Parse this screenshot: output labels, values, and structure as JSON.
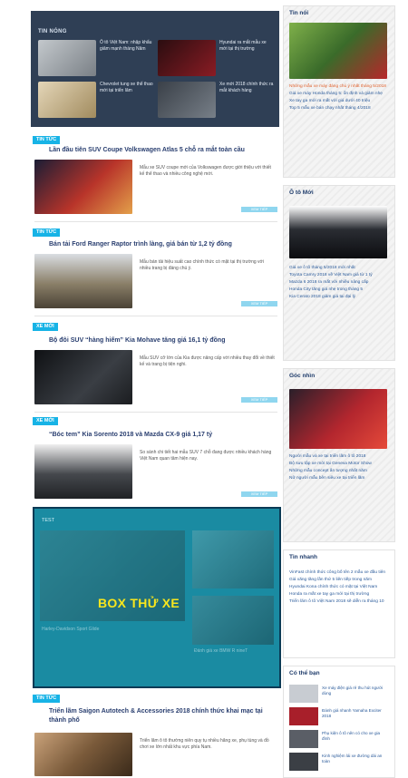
{
  "featured": {
    "header": "TIN NÓNG",
    "items": [
      {
        "caption": "Ô tô Việt Nam: nhập khẩu giảm mạnh tháng Năm",
        "color": "#9aa3a8"
      },
      {
        "caption": "Hyundai ra mắt mẫu xe mới tại thị trường",
        "color": "#7a1a20"
      },
      {
        "caption": "Chevrolet tung xe thể thao mới tại triển lãm",
        "color": "#c9b38a"
      },
      {
        "caption": "Xe mới 2018 chính thức ra mắt khách hàng",
        "color": "#4b5560"
      }
    ]
  },
  "articles": [
    {
      "tag": "TIN TỨC",
      "title": "Lần đầu tiên SUV Coupe Volkswagen Atlas 5 chỗ ra mắt toàn cầu",
      "summary": "Mẫu xe SUV coupe mới của Volkswagen được giới thiệu với thiết kế thể thao và nhiều công nghệ mới.",
      "more": "XEM TIẾP",
      "color": "#b8342a"
    },
    {
      "tag": "TIN TỨC",
      "title": "Bán tải Ford Ranger Raptor trình làng, giá bán từ 1,2 tỷ đồng",
      "summary": "Mẫu bán tải hiệu suất cao chính thức có mặt tại thị trường với nhiều trang bị đáng chú ý.",
      "more": "XEM TIẾP",
      "color": "#8a7f68"
    },
    {
      "tag": "XE MỚI",
      "title": "Bộ đôi SUV “hàng hiếm” Kia Mohave tăng giá 16,1 tỷ đồng",
      "summary": "Mẫu SUV cỡ lớn của Kia được nâng cấp với nhiều thay đổi về thiết kế và trang bị tiện nghi.",
      "more": "XEM TIẾP",
      "color": "#2b2e33"
    },
    {
      "tag": "XE MỚI",
      "title": "“Bóc tem” Kia Sorento 2018 và Mazda CX-9 giá 1,17 tỷ",
      "summary": "So sánh chi tiết hai mẫu SUV 7 chỗ đang được nhiều khách hàng Việt Nam quan tâm hiện nay.",
      "more": "XEM TIẾP",
      "color": "#45484d"
    },
    {
      "tag": "TIN TỨC",
      "title": "Triển lãm Saigon Autotech & Accessories 2018 chính thức khai mạc",
      "title2": "tại thành phố",
      "summary": "Triển lãm ô tô thường niên quy tụ nhiều hãng xe, phụ tùng và đồ chơi xe lớn nhất khu vực phía Nam.",
      "more": "",
      "color": "#7a5a3a"
    }
  ],
  "testbox": {
    "label": "TEST",
    "title": "BOX THỬ XE",
    "items": [
      "Harley-Davidson Sport Glide",
      "Đánh giá xe BMW R nineT",
      "Trải nghiệm Ducati Monster 2018"
    ]
  },
  "sidebar": {
    "widgets": [
      {
        "title": "Tin nổi",
        "img_color": "#3a6b2a",
        "items": [
          {
            "text": "Những mẫu xe máy đáng chú ý nhất tháng 5/2018",
            "bold": true
          },
          {
            "text": "Giá xe máy Honda tháng 5: ổn định và giảm nhẹ",
            "bold": false
          },
          {
            "text": "Xe tay ga mới ra mắt với giá dưới 40 triệu",
            "bold": false
          },
          {
            "text": "Top 5 mẫu xe bán chạy nhất tháng 4/2018",
            "bold": false
          }
        ]
      },
      {
        "title": "Ô tô Mới",
        "img_color": "#1c1f24",
        "items": [
          {
            "text": "Giá xe ô tô tháng 5/2018 mới nhất",
            "bold": false
          },
          {
            "text": "Toyota Camry 2018 về Việt Nam giá từ 1 tỷ",
            "bold": false
          },
          {
            "text": "Mazda 6 2018 ra mắt với nhiều nâng cấp",
            "bold": false
          },
          {
            "text": "Honda City tăng giá nhẹ trong tháng 5",
            "bold": false
          },
          {
            "text": "Kia Cerato 2018 giảm giá tại đại lý",
            "bold": false
          }
        ]
      },
      {
        "title": "Góc nhìn",
        "img_color": "#8a1a1f",
        "items": [
          {
            "text": "Người mẫu và xe tại triển lãm ô tô 2018",
            "bold": false
          },
          {
            "text": "Bộ sưu tập xe mới tại Geneva Motor Show",
            "bold": false
          },
          {
            "text": "Những mẫu concept ấn tượng nhất năm",
            "bold": false
          },
          {
            "text": "Nữ người mẫu bên siêu xe tại triển lãm",
            "bold": false
          }
        ]
      }
    ],
    "list_widget": {
      "title": "Tin nhanh",
      "items": [
        "VinFast chính thức công bố tên 2 mẫu xe đầu tiên",
        "Giá xăng tăng lần thứ 5 liên tiếp trong năm",
        "Hyundai Kona chính thức có mặt tại Việt Nam",
        "Honda ra mắt xe tay ga mới tại thị trường",
        "Triển lãm ô tô Việt Nam 2018 sẽ diễn ra tháng 10"
      ]
    },
    "thumb_widget": {
      "title": "Có thể bạn",
      "items": [
        {
          "text": "Xe máy điện giá rẻ thu hút người dùng",
          "color": "#c8ccd2"
        },
        {
          "text": "Đánh giá nhanh Yamaha Exciter 2018",
          "color": "#a81f2a"
        },
        {
          "text": "Phụ kiện ô tô nên có cho xe gia đình",
          "color": "#5a5e66"
        },
        {
          "text": "Kinh nghiệm lái xe đường dài an toàn",
          "color": "#3b3f45"
        }
      ]
    }
  }
}
